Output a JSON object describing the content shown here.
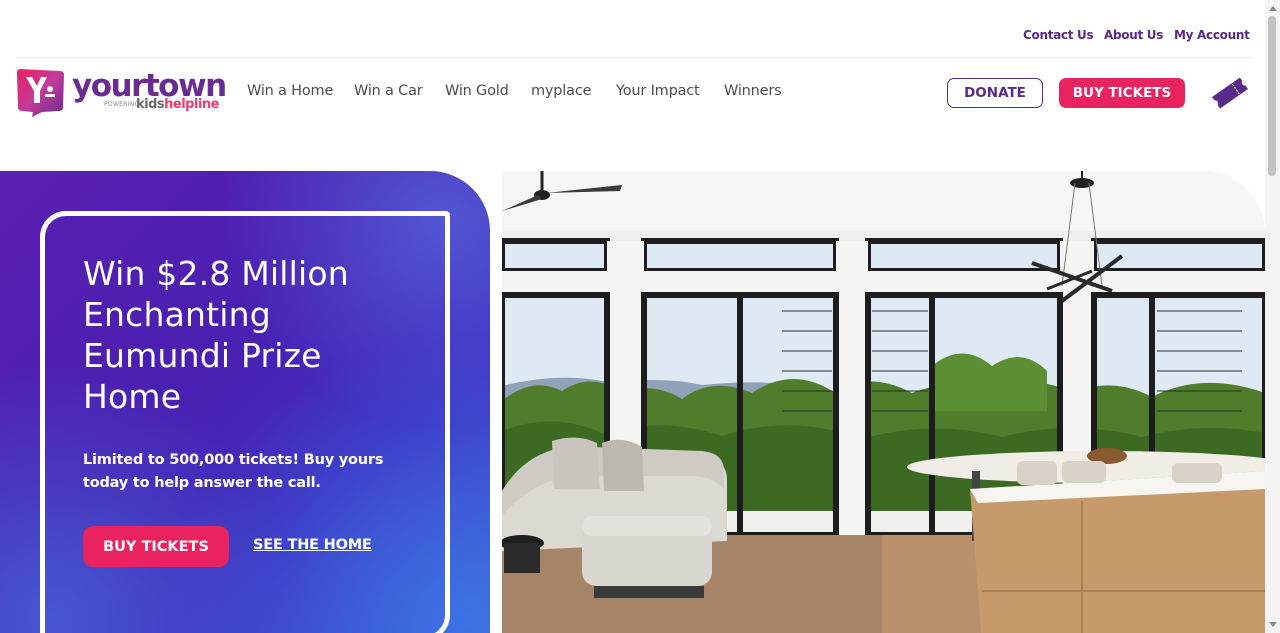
{
  "utility_nav": {
    "contact": "Contact Us",
    "about": "About Us",
    "account": "My Account"
  },
  "logo": {
    "wordmark": "yourtown",
    "powering": "POWERING",
    "kids": "kids",
    "helpline": "helpline"
  },
  "main_nav": [
    "Win a Home",
    "Win a Car",
    "Win Gold",
    "myplace",
    "Your Impact",
    "Winners"
  ],
  "header_buttons": {
    "donate": "DONATE",
    "buy_tickets": "BUY TICKETS"
  },
  "hero": {
    "title": "Win $2.8 Million Enchanting Eumundi Prize Home",
    "subtitle": "Limited to 500,000 tickets! Buy yours today to help answer the call.",
    "buy_tickets": "BUY TICKETS",
    "see_home": "SEE THE HOME"
  },
  "icons": {
    "ticket": "ticket-icon",
    "logo_mark": "yourtown-logo-mark"
  },
  "colors": {
    "brand_purple": "#5a2a8a",
    "brand_pink": "#e8235f",
    "hero_purple": "#4a1fb0"
  }
}
